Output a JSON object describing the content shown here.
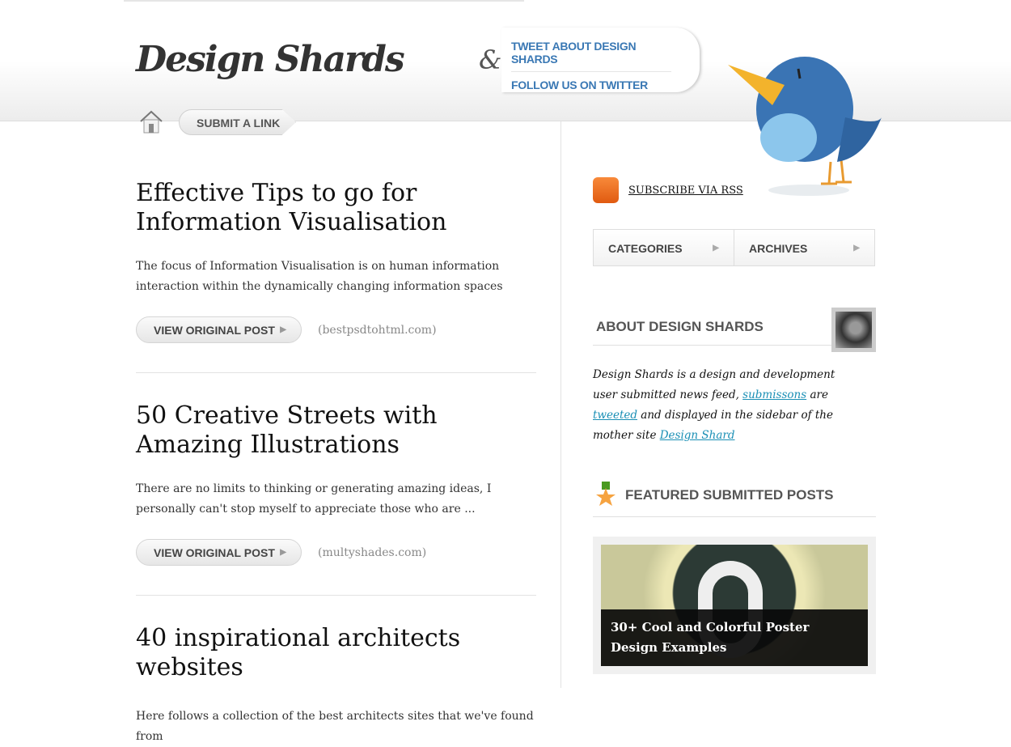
{
  "header": {
    "logo": "Design Shards",
    "amp": "&",
    "tweet": "TWEET ABOUT DESIGN SHARDS",
    "follow": "FOLLOW US ON TWITTER",
    "submit": "SUBMIT A LINK"
  },
  "posts": [
    {
      "title": "Effective Tips to go for Information Visualisation",
      "excerpt": "The focus of Information Visualisation is on human information interaction within the dynamically changing information spaces",
      "button": "VIEW ORIGINAL POST",
      "source": "(bestpsdtohtml.com)"
    },
    {
      "title": "50 Creative Streets with Amazing Illustrations",
      "excerpt": "There are no limits to thinking or generating amazing ideas, I personally can't stop myself to appreciate those who are ...",
      "button": "VIEW ORIGINAL POST",
      "source": "(multyshades.com)"
    },
    {
      "title": "40 inspirational architects websites",
      "excerpt": "Here follows a collection of the best architects sites that we've found from"
    }
  ],
  "sidebar": {
    "rss": "SUBSCRIBE VIA RSS",
    "tabs": [
      "CATEGORIES",
      "ARCHIVES"
    ],
    "about_title": "ABOUT DESIGN SHARDS",
    "about": {
      "t1": "Design Shards is a design and development user submitted news feed, ",
      "l1": "submissons",
      "t2": " are ",
      "l2": "tweeted",
      "t3": " and displayed in the sidebar of the mother site ",
      "l3": "Design Shard"
    },
    "featured_title": "FEATURED SUBMITTED POSTS",
    "featured_post": "30+ Cool and Colorful Poster Design Examples"
  },
  "colors": {
    "link_blue": "#3a78b4",
    "about_link": "#1a8fb5"
  }
}
